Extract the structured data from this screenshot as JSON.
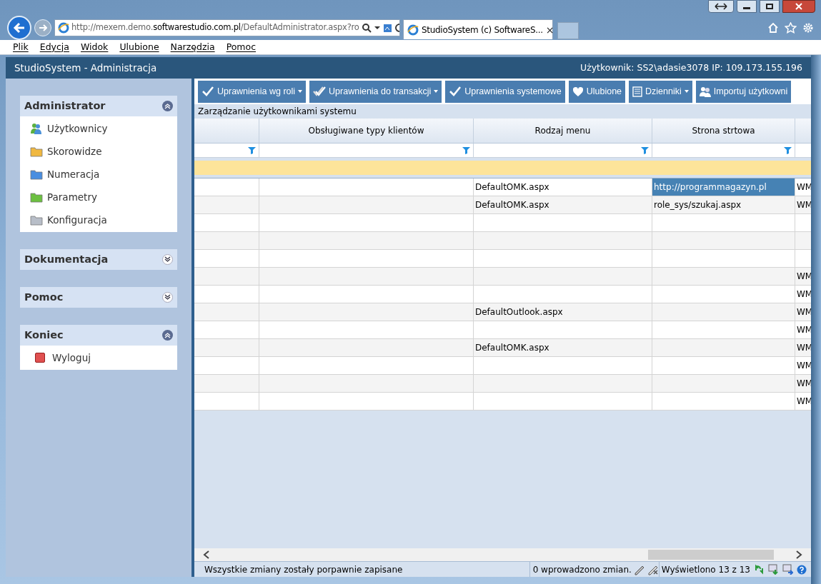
{
  "browser": {
    "url_prefix": "http://mexem.demo.",
    "url_domain": "softwarestudio.com.pl",
    "url_rest": "/DefaultAdministrator.aspx?ro",
    "tab_title": "StudioSystem (c) SoftwareS...",
    "tab_close": "×",
    "menu": [
      "Plik",
      "Edycja",
      "Widok",
      "Ulubione",
      "Narzędzia",
      "Pomoc"
    ]
  },
  "app": {
    "title": "StudioSystem - Administracja",
    "user_info": "Użytkownik: SS2\\adasie3078 IP: 109.173.155.196"
  },
  "sidebar": [
    {
      "title": "Administrator",
      "expanded": true,
      "items": [
        {
          "label": "Użytkownicy",
          "kind": "users",
          "color": "#4a90d9"
        },
        {
          "label": "Skorowidze",
          "kind": "folder",
          "color": "#f0b840"
        },
        {
          "label": "Numeracja",
          "kind": "folder",
          "color": "#4a8ee0"
        },
        {
          "label": "Parametry",
          "kind": "folder",
          "color": "#6cc040"
        },
        {
          "label": "Konfiguracja",
          "kind": "folder",
          "color": "#b8bec8"
        }
      ]
    },
    {
      "title": "Dokumentacja",
      "expanded": false
    },
    {
      "title": "Pomoc",
      "expanded": false
    },
    {
      "title": "Koniec",
      "expanded": true,
      "items": [
        {
          "label": "Wyloguj",
          "kind": "stop",
          "color": "#e05050"
        }
      ]
    }
  ],
  "toolbar": [
    {
      "label": "Uprawnienia wg roli",
      "kind": "check",
      "dropdown": true
    },
    {
      "label": "Uprawnienia do transakcji",
      "kind": "double-check",
      "dropdown": true
    },
    {
      "label": "Uprawnienia systemowe",
      "kind": "check",
      "dropdown": false
    },
    {
      "label": "Ulubione",
      "kind": "heart",
      "dropdown": false
    },
    {
      "label": "Dzienniki",
      "kind": "list",
      "dropdown": true
    },
    {
      "label": "Importuj użytkowni",
      "kind": "users",
      "dropdown": false
    }
  ],
  "grid": {
    "title": "Zarządzanie użytkownikami systemu",
    "columns": [
      "Obsługiwane typy klientów",
      "Rodzaj menu",
      "Strona strtowa"
    ],
    "rows": [
      {
        "rodzaj_menu": "DefaultOMK.aspx",
        "strona_strtowa": "http://programmagazyn.pl",
        "column_5": "WM",
        "selected": true
      },
      {
        "rodzaj_menu": "DefaultOMK.aspx",
        "strona_strtowa": "role_sys/szukaj.aspx",
        "column_5": "WM",
        "selected": false
      },
      {
        "selected": false
      },
      {
        "selected": false
      },
      {
        "selected": false
      },
      {
        "column_5": "WM",
        "selected": false
      },
      {
        "column_5": "WM",
        "selected": false
      },
      {
        "rodzaj_menu": "DefaultOutlook.aspx",
        "column_5": "WM",
        "selected": false
      },
      {
        "column_5": "WM",
        "selected": false
      },
      {
        "rodzaj_menu": "DefaultOMK.aspx",
        "column_5": "WM",
        "selected": false
      },
      {
        "column_5": "WM",
        "selected": false
      },
      {
        "column_5": "WM",
        "selected": false
      },
      {
        "column_5": "WM",
        "selected": false
      }
    ]
  },
  "status_bar": {
    "message": "Wszystkie zmiany zostały porpawnie zapisane",
    "changes": "0 wprowadzono zmian.",
    "count": "Wyświetlono 13 z 13"
  }
}
